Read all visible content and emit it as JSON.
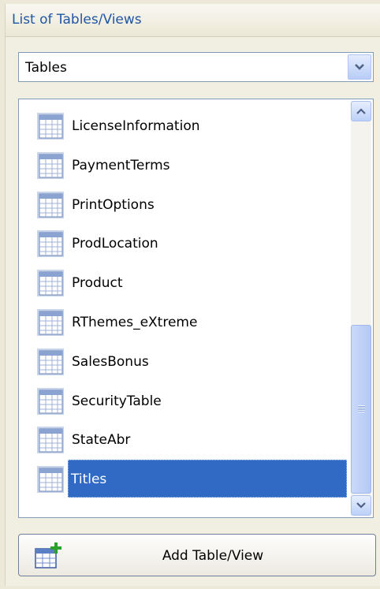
{
  "panel": {
    "title": "List of Tables/Views"
  },
  "object_type_select": {
    "value": "Tables"
  },
  "table_list": {
    "items": [
      {
        "label": "LicenseInformation",
        "selected": false
      },
      {
        "label": "PaymentTerms",
        "selected": false
      },
      {
        "label": "PrintOptions",
        "selected": false
      },
      {
        "label": "ProdLocation",
        "selected": false
      },
      {
        "label": "Product",
        "selected": false
      },
      {
        "label": "RThemes_eXtreme",
        "selected": false
      },
      {
        "label": "SalesBonus",
        "selected": false
      },
      {
        "label": "SecurityTable",
        "selected": false
      },
      {
        "label": "StateAbr",
        "selected": false
      },
      {
        "label": "Titles",
        "selected": true
      }
    ],
    "item_icon": "table-icon"
  },
  "add_button": {
    "label": "Add Table/View",
    "icon": "add-table-icon"
  },
  "colors": {
    "selection": "#316ac5",
    "header_text": "#2155a5",
    "panel_bg": "#f1efe2"
  }
}
